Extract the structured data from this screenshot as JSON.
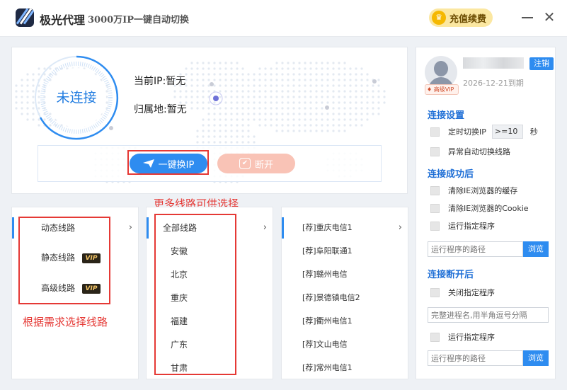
{
  "window": {
    "app_name": "极光代理",
    "slogan": "3000万IP一键自动切换",
    "recharge_label": "充值续费",
    "minimize_label": "",
    "close_label": "✕"
  },
  "connection": {
    "status": "未连接",
    "current_ip_label": "当前IP:暂无",
    "location_label": "归属地:暂无",
    "switch_button": "一键换IP",
    "disconnect_button": "断开"
  },
  "route_types": {
    "items": [
      {
        "label": "动态线路",
        "vip": false
      },
      {
        "label": "静态线路",
        "vip": true
      },
      {
        "label": "高级线路",
        "vip": true
      }
    ],
    "vip_badge": "VIP"
  },
  "annotations": {
    "more_routes": "更多线路可供选择",
    "choose_by_need": "根据需求选择线路"
  },
  "regions": {
    "items": [
      "全部线路",
      "安徽",
      "北京",
      "重庆",
      "福建",
      "广东",
      "甘肃"
    ]
  },
  "servers": {
    "items": [
      "[荐]重庆电信1",
      "[荐]阜阳联通1",
      "[荐]赣州电信",
      "[荐]景德镇电信2",
      "[荐]衢州电信1",
      "[荐]文山电信",
      "[荐]常州电信1"
    ]
  },
  "account": {
    "logout": "注销",
    "expire": "2026-12-21到期",
    "level": "高级VIP"
  },
  "settings": {
    "conn_title": "连接设置",
    "timed_switch": "定时切换IP",
    "interval_value": ">=10",
    "seconds": "秒",
    "auto_switch": "异常自动切换线路",
    "after_conn_title": "连接成功后",
    "clear_cache": "清除IE浏览器的缓存",
    "clear_cookie": "清除IE浏览器的Cookie",
    "run_program": "运行指定程序",
    "path_placeholder": "运行程序的路径",
    "browse": "浏览",
    "after_disc_title": "连接断开后",
    "close_program": "关闭指定程序",
    "process_placeholder": "完整进程名,用半角逗号分隔",
    "run_program2": "运行指定程序",
    "path_placeholder2": "运行程序的路径",
    "browse2": "浏览"
  },
  "colors": {
    "accent": "#2e8cf0",
    "annotation": "#e53935",
    "disconnect": "#f9c3b6",
    "gold": "#f5b800"
  }
}
